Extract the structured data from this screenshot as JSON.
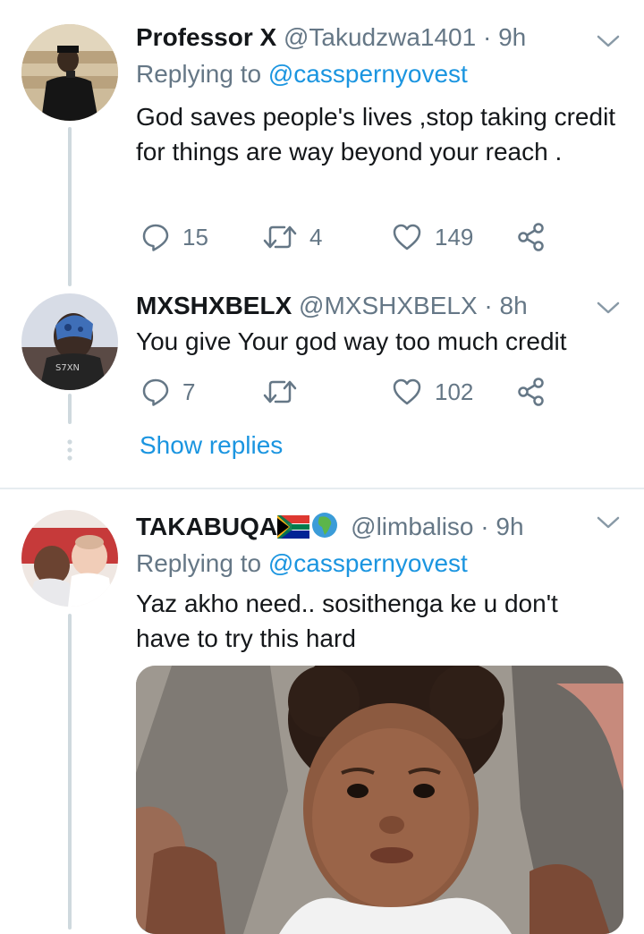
{
  "tweets": [
    {
      "name": "Professor X",
      "handle": "@Takudzwa1401",
      "separator": "·",
      "time": "9h",
      "replying_label": "Replying to",
      "replying_to": "@casspernyovest",
      "text": "God saves people's lives ,stop taking credit for things are way beyond your reach .",
      "replies": "15",
      "retweets": "4",
      "likes": "149"
    },
    {
      "name": "MXSHXBELX",
      "handle": "@MXSHXBELX",
      "separator": "·",
      "time": "8h",
      "text": "You give Your god way too much credit",
      "replies": "7",
      "retweets": "",
      "likes": "102"
    },
    {
      "name": "TAKABUQA",
      "handle": "@limbaliso",
      "separator": "·",
      "time": "9h",
      "replying_label": "Replying to",
      "replying_to": "@casspernyovest",
      "text": "Yaz akho need.. sosithenga ke u don't have to try this hard",
      "name_emojis": [
        "south-africa-flag",
        "globe-africa"
      ]
    }
  ],
  "show_replies": "Show replies",
  "colors": {
    "link": "#1b95e0",
    "secondary": "#657786",
    "thread_line": "#cfd9de",
    "divider": "#e6ecf0"
  },
  "icons": [
    "reply-icon",
    "retweet-icon",
    "like-icon",
    "share-icon",
    "chevron-down-icon"
  ]
}
